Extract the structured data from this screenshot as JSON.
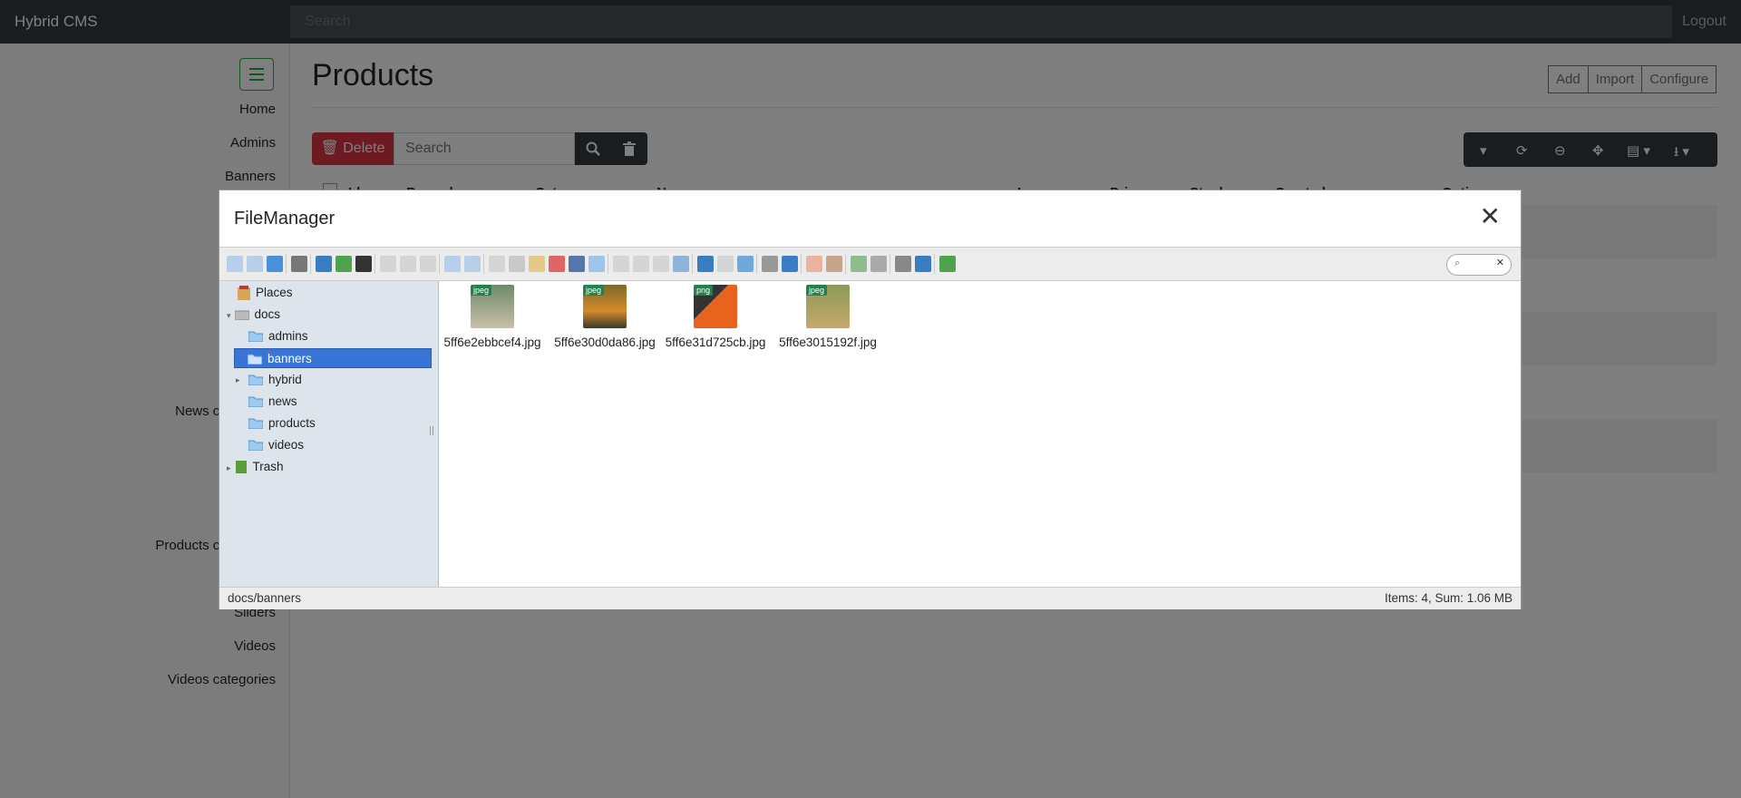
{
  "app": {
    "brand": "Hybrid CMS",
    "search_placeholder": "Search",
    "logout": "Logout"
  },
  "sidebar": {
    "items": [
      {
        "label": "Home"
      },
      {
        "label": "Admins"
      },
      {
        "label": "Banners"
      },
      {
        "label": "News categories"
      },
      {
        "label": "Products categories"
      },
      {
        "label": "Sliders"
      },
      {
        "label": "Videos"
      },
      {
        "label": "Videos categories"
      }
    ]
  },
  "page": {
    "title": "Products",
    "actions": [
      "Add",
      "Import",
      "Configure"
    ],
    "delete_label": "Delete",
    "table_search_placeholder": "Search",
    "columns": [
      "Id",
      "Barcode",
      "Category",
      "Name",
      "Image",
      "Price",
      "Stock",
      "Created",
      "Options"
    ]
  },
  "filemanager": {
    "title": "FileManager",
    "tree": {
      "places": "Places",
      "root": "docs",
      "folders": [
        "admins",
        "banners",
        "hybrid",
        "news",
        "products",
        "videos"
      ],
      "selected": "banners",
      "trash": "Trash"
    },
    "files": [
      {
        "name": "5ff6e2ebbcef4.jpg",
        "type": "jpeg"
      },
      {
        "name": "5ff6e30d0da86.jpg",
        "type": "jpeg"
      },
      {
        "name": "5ff6e31d725cb.jpg",
        "type": "png"
      },
      {
        "name": "5ff6e3015192f.jpg",
        "type": "jpeg"
      }
    ],
    "status": {
      "path": "docs/banners",
      "summary": "Items: 4, Sum: 1.06 MB"
    }
  },
  "colors": {
    "topbar": "#343a40",
    "danger": "#dc3545",
    "success": "#28a745",
    "info": "#17a2b8",
    "selected": "#3875d7"
  }
}
